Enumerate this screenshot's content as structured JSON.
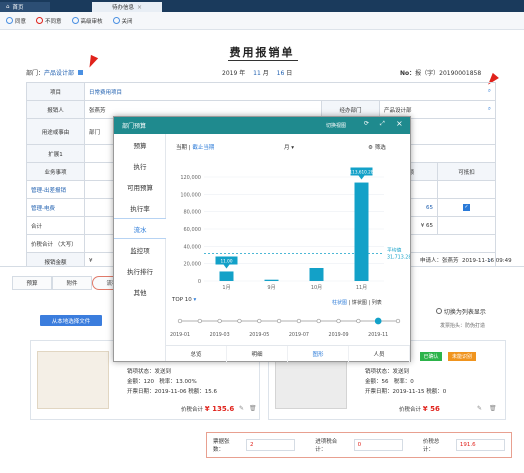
{
  "tabs": {
    "home": "首页",
    "active": "待办信息"
  },
  "toolbar": {
    "agree": "同意",
    "disagree": "不同意",
    "advanced": "高级审核",
    "close": "关闭"
  },
  "form": {
    "title": "费用报销单",
    "dept_label": "部门：",
    "dept_value": "产品设计部",
    "date": {
      "year": "2019",
      "year_unit": "年",
      "month": "11",
      "month_unit": "月",
      "day": "16",
      "day_unit": "日"
    },
    "no_label": "No：",
    "no_value": "报（字）20190001858",
    "rows": {
      "project_label": "项目",
      "project_value": "日常费用项目",
      "applicant_label": "报销人",
      "applicant_value": "张燕芳",
      "handler_dept_label": "经办部门",
      "handler_dept_value": "产品设计部",
      "purpose_label": "用途或事由",
      "purpose_value": "部门",
      "ext_label": "扩展1",
      "biz_label": "业务事项",
      "tax_label": "税额",
      "deduct_label": "可抵扣",
      "mgmt1": "管理-出差报销",
      "mgmt2": "管理-电费",
      "amount_65a": "65",
      "amount_65b": "¥ 65",
      "total_label": "合计",
      "pricetax_label": "价税合计",
      "pricetax_upper": "（大写）",
      "reimb_amount_label": "报销金额",
      "currency": "¥",
      "applicant_sig": "申请人：张燕芳",
      "timestamp": "2019-11-16 09:49"
    }
  },
  "lower": {
    "tabs": [
      "预算",
      "附件",
      "流程"
    ],
    "local_upload": "从本地选择文件",
    "switch_list": "切换为列表显示",
    "invoice_head": "发票抬头：防伪打造",
    "invoice1": {
      "status": "发送到",
      "amount_label": "金额：",
      "amount": "120",
      "tax_rate_label": "税率：",
      "tax_rate": "13.00%",
      "date_label": "开票日期：",
      "date": "2019-11-06",
      "tax_label": "税额：",
      "tax": "15.6",
      "total_label": "价税合计",
      "total": "¥ 135.6"
    },
    "invoice2": {
      "status": "发送到",
      "amount_label": "金额：",
      "amount": "56",
      "tax_rate_label": "税率：",
      "tax_rate": "0",
      "date_label": "开票日期：",
      "date": "2019-11-15",
      "tax_label": "税额：",
      "tax": "0",
      "total_label": "价税合计",
      "total": "¥ 56"
    },
    "confirmed": "已确认",
    "unrecognized": "未能识别",
    "totals": {
      "count_label": "票据张数：",
      "count": "2",
      "tax_label": "进项税合计：",
      "tax": "0",
      "total_label": "价税总计：",
      "total": "191.6"
    }
  },
  "modal": {
    "title": "部门预算",
    "window_label": "切换视图",
    "side": [
      "预算",
      "执行",
      "可用预算",
      "执行率",
      "流水",
      "监控项",
      "执行排行",
      "其他"
    ],
    "period_label": "当期",
    "period_cut": "截止当期",
    "unit": "月",
    "filter": "筛选",
    "top10": "TOP 10",
    "view_bar": "柱状图",
    "view_ring": "饼状图",
    "view_list": "列表",
    "avg_label": "平均值",
    "avg_value": "31,713.28",
    "bottom_tabs": [
      "总览",
      "明细",
      "图形",
      "人员"
    ],
    "timeline": [
      "2019-01",
      "2019-03",
      "2019-05",
      "2019-07",
      "2019-09",
      "2019-11"
    ]
  },
  "chart_data": {
    "type": "bar",
    "categories": [
      "1月",
      "9月",
      "10月",
      "11月"
    ],
    "values": [
      11000,
      1500,
      15000,
      113600
    ],
    "bar_labels": [
      "11.00",
      "",
      "",
      "113,610.28"
    ],
    "yticks": [
      "0",
      "20,000",
      "40,000",
      "60,000",
      "80,000",
      "100,000",
      "120,000"
    ],
    "ylim": [
      0,
      120000
    ],
    "avg": 31713.28
  }
}
